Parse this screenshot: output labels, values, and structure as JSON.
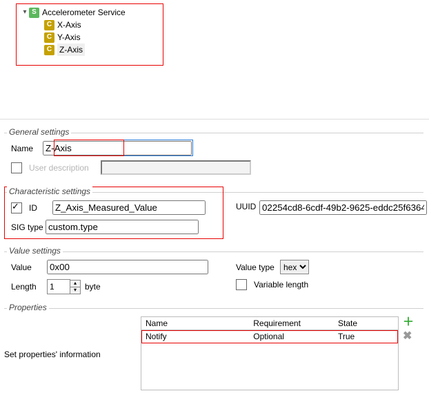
{
  "tree": {
    "service": "Accelerometer Service",
    "items": [
      "X-Axis",
      "Y-Axis",
      "Z-Axis"
    ],
    "selected": 2
  },
  "general": {
    "legend": "General settings",
    "name_label": "Name",
    "name_value": "Z-Axis",
    "userdesc_label": "User description",
    "userdesc_value": ""
  },
  "char": {
    "legend": "Characteristic settings",
    "id_label": "ID",
    "id_value": "Z_Axis_Measured_Value",
    "sig_label": "SIG type",
    "sig_value": "custom.type",
    "uuid_label": "UUID",
    "uuid_value": "02254cd8-6cdf-49b2-9625-eddc25f6364"
  },
  "val": {
    "legend": "Value settings",
    "value_label": "Value",
    "value_value": "0x00",
    "valuetype_label": "Value type",
    "valuetype_value": "hex",
    "length_label": "Length",
    "length_value": "1",
    "length_unit": "byte",
    "varlen_label": "Variable length"
  },
  "prop": {
    "legend": "Properties",
    "help": "Set properties' information",
    "cols": [
      "Name",
      "Requirement",
      "State"
    ],
    "rows": [
      {
        "name": "Notify",
        "req": "Optional",
        "state": "True"
      }
    ]
  }
}
